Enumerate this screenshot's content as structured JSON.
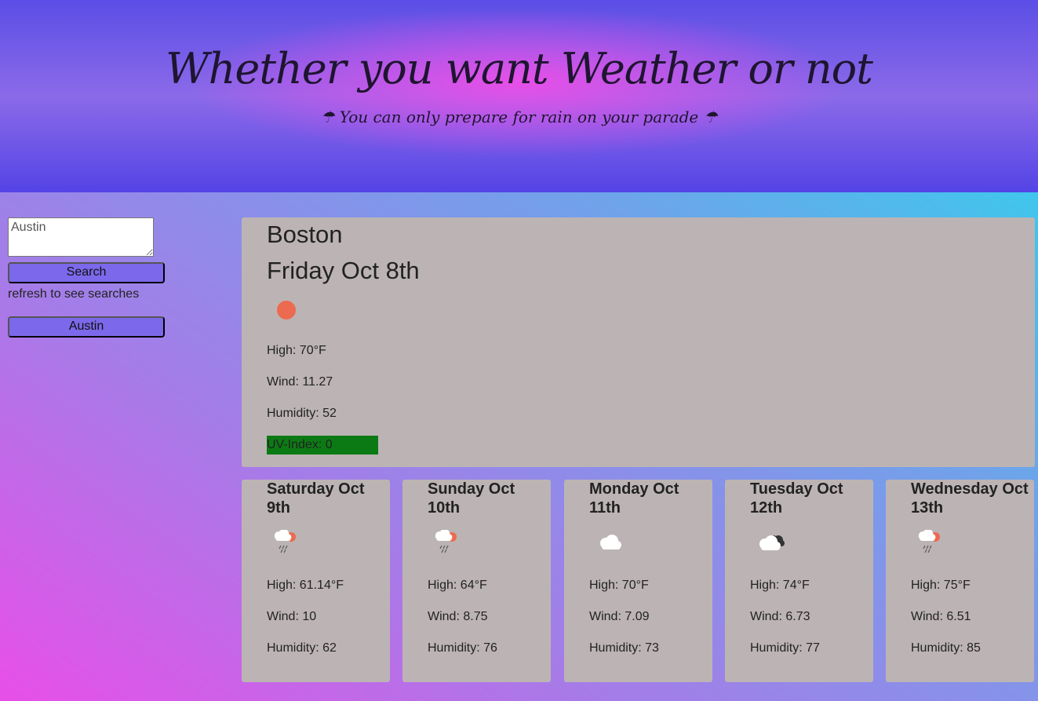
{
  "header": {
    "title": "Whether you want Weather or not",
    "tagline": "☂ You can only prepare for rain on your parade ☂"
  },
  "sidebar": {
    "search_input_value": "Austin",
    "search_button_label": "Search",
    "refresh_note": "refresh to see searches",
    "history": [
      "Austin"
    ]
  },
  "current": {
    "city": "Boston",
    "date": "Friday Oct 8th",
    "icon": "clear-sun-icon",
    "high": "High: 70°F",
    "wind": "Wind: 11.27",
    "humidity": "Humidity: 52",
    "uv": "UV-Index: 0",
    "uv_color": "#0c7a14"
  },
  "forecast": [
    {
      "date": "Saturday Oct 9th",
      "icon": "rain-sun-icon",
      "high": "High: 61.14°F",
      "wind": "Wind: 10",
      "humidity": "Humidity: 62"
    },
    {
      "date": "Sunday Oct 10th",
      "icon": "rain-sun-icon",
      "high": "High: 64°F",
      "wind": "Wind: 8.75",
      "humidity": "Humidity: 76"
    },
    {
      "date": "Monday Oct 11th",
      "icon": "cloud-icon",
      "high": "High: 70°F",
      "wind": "Wind: 7.09",
      "humidity": "Humidity: 73"
    },
    {
      "date": "Tuesday Oct 12th",
      "icon": "broken-clouds-icon",
      "high": "High: 74°F",
      "wind": "Wind: 6.73",
      "humidity": "Humidity: 77"
    },
    {
      "date": "Wednesday Oct 13th",
      "icon": "rain-sun-icon",
      "high": "High: 75°F",
      "wind": "Wind: 6.51",
      "humidity": "Humidity: 85"
    }
  ]
}
